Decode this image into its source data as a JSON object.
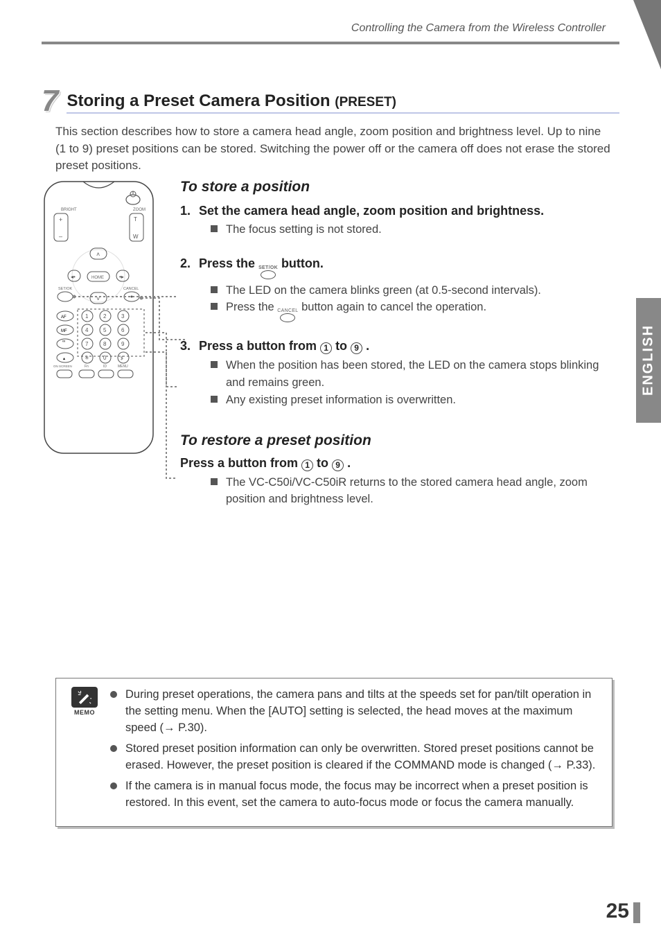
{
  "header": {
    "running": "Controlling the Camera from the Wireless Controller"
  },
  "section": {
    "number": "7",
    "title_main": "Storing a Preset Camera Position ",
    "title_paren": "(PRESET)"
  },
  "intro": "This section describes how to store a camera head angle, zoom position and brightness level. Up to nine (1 to 9) preset positions can be stored. Switching the power off or the camera off does not erase the stored preset positions.",
  "store": {
    "heading": "To store a position",
    "step1": {
      "num": "1.",
      "text": "Set the camera head angle, zoom position and brightness.",
      "b1": "The focus setting is not stored."
    },
    "step2": {
      "num": "2.",
      "prefix": "Press the ",
      "icon_label": "SET/OK",
      "suffix": " button.",
      "b1": "The LED on the camera blinks green (at 0.5-second intervals).",
      "b2_prefix": "Press the ",
      "b2_icon": "CANCEL",
      "b2_suffix": " button again to cancel the operation."
    },
    "step3": {
      "num": "3.",
      "prefix": "Press a button from ",
      "from": "1",
      "mid": " to ",
      "to": "9",
      "suffix": ".",
      "b1": "When the position has been stored, the LED on the camera stops blinking and remains green.",
      "b2": "Any existing preset information is overwritten."
    }
  },
  "restore": {
    "heading": "To restore a preset position",
    "line_prefix": "Press a button from ",
    "from": "1",
    "mid": " to ",
    "to": "9",
    "suffix": ".",
    "b1": "The VC-C50i/VC-C50iR returns to the stored camera head angle, zoom position and brightness level."
  },
  "side_tab": "ENGLISH",
  "memo": {
    "label": "MEMO",
    "items": [
      "During preset operations, the camera pans and tilts at the speeds set for pan/tilt operation in the setting menu. When the [AUTO] setting is selected, the head moves at the maximum speed (→ P.30).",
      "Stored preset position information can only be overwritten. Stored preset positions cannot be erased. However, the preset position is cleared if the COMMAND mode is changed (→ P.33).",
      "If the camera is in manual focus mode, the focus may be incorrect when a preset position is restored. In this event, set the camera to auto-focus mode or focus the camera manually."
    ]
  },
  "page_number": "25",
  "remote": {
    "bright": "BRIGHT",
    "zoom": "ZOOM",
    "home": "HOME",
    "setok": "SET/OK",
    "cancel": "CANCEL",
    "af": "AF",
    "mf": "MF",
    "inf": "∞",
    "near": "▴",
    "star": "✳",
    "zero": "0",
    "hash": "♯",
    "bottom": [
      "ON SCREEN",
      "Fn",
      "ID",
      "MENU"
    ],
    "numbers": [
      "1",
      "2",
      "3",
      "4",
      "5",
      "6",
      "7",
      "8",
      "9"
    ]
  }
}
